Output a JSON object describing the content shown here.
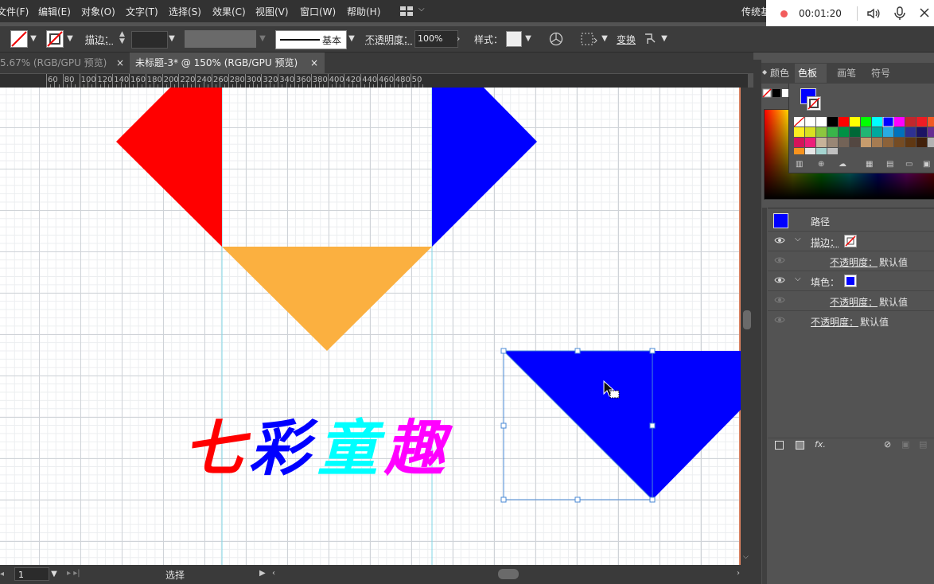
{
  "menu": {
    "items": [
      "文件(F)",
      "编辑(E)",
      "对象(O)",
      "文字(T)",
      "选择(S)",
      "效果(C)",
      "视图(V)",
      "窗口(W)",
      "帮助(H)"
    ],
    "workspace": "传统基"
  },
  "recorder": {
    "time": "00:01:20"
  },
  "control": {
    "stroke_label": "描边：",
    "stroke_style": "基本",
    "opacity_label": "不透明度：",
    "opacity_value": "100%",
    "style_label": "样式：",
    "transform_label": "变换"
  },
  "tabs": [
    {
      "label": "5.67% (RGB/GPU 预览)",
      "active": false
    },
    {
      "label": "未标题-3* @ 150% (RGB/GPU 预览)",
      "active": true
    }
  ],
  "ruler": {
    "labels": [
      "60",
      "80",
      "100",
      "120",
      "140",
      "160",
      "180",
      "200",
      "220",
      "240",
      "260",
      "280",
      "300",
      "320",
      "340",
      "360",
      "380",
      "400",
      "420",
      "440",
      "460",
      "480",
      "50"
    ]
  },
  "artwork": {
    "text": {
      "chars": [
        "七",
        "彩",
        "童",
        "趣"
      ]
    },
    "colors": {
      "red": "#ff0000",
      "blue": "#0000ff",
      "orange": "#fbb040",
      "cyan": "#00ffff",
      "magenta": "#ff00ff"
    }
  },
  "panels": {
    "tabs": [
      "颜色",
      "色板",
      "画笔",
      "符号"
    ],
    "active_tab": "色板",
    "appearance": {
      "title": "路径",
      "stroke_label": "描边：",
      "fill_label": "填色：",
      "opacity_label": "不透明度：",
      "default_value": "默认值"
    }
  },
  "status": {
    "zoom": "1",
    "tool": "选择"
  }
}
